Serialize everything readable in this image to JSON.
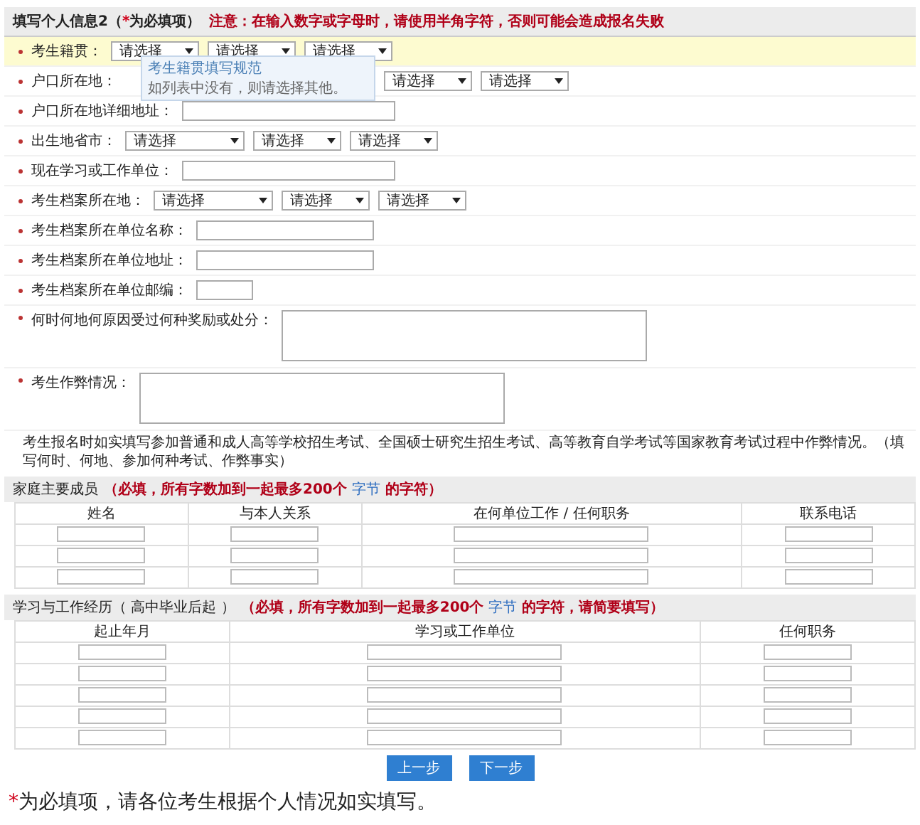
{
  "header": {
    "title": "填写个人信息2（",
    "required_mark": "*",
    "title_end": "为必填项）",
    "warning": "注意：在输入数字或字母时，请使用半角字符，否则可能会造成报名失败"
  },
  "tooltip": {
    "title": "考生籍贯填写规范",
    "text": "如列表中没有，则请选择其他。"
  },
  "rows": [
    {
      "label": "考生籍贯：",
      "required": true,
      "highlighted": true,
      "kind": "select",
      "selects": [
        {
          "text": "请选择",
          "kind": "narrow"
        },
        {
          "text": "请选择",
          "kind": "narrow"
        },
        {
          "text": "请选择",
          "kind": "narrow"
        }
      ]
    },
    {
      "label": "户口所在地：",
      "required": true,
      "highlighted": false,
      "kind": "select",
      "selects": [
        {
          "text": "请选择",
          "kind": "narrow"
        },
        {
          "text": "请选择",
          "kind": "narrow"
        }
      ]
    },
    {
      "label": "户口所在地详细地址：",
      "required": true,
      "highlighted": false,
      "kind": "input"
    },
    {
      "label": "出生地省市：",
      "required": true,
      "highlighted": false,
      "kind": "select",
      "selects": [
        {
          "text": "请选择",
          "kind": "wide"
        },
        {
          "text": "请选择",
          "kind": "narrow"
        },
        {
          "text": "请选择",
          "kind": "narrow"
        }
      ]
    },
    {
      "label": "现在学习或工作单位：",
      "required": true,
      "highlighted": false,
      "kind": "input"
    },
    {
      "label": "考生档案所在地：",
      "required": true,
      "highlighted": false,
      "kind": "select",
      "selects": [
        {
          "text": "请选择",
          "kind": "wide"
        },
        {
          "text": "请选择",
          "kind": "narrow"
        },
        {
          "text": "请选择",
          "kind": "narrow"
        }
      ]
    },
    {
      "label": "考生档案所在单位名称：",
      "required": true,
      "highlighted": false,
      "kind": "input"
    },
    {
      "label": "考生档案所在单位地址：",
      "required": true,
      "highlighted": false,
      "kind": "input"
    },
    {
      "label": "考生档案所在单位邮编：",
      "required": true,
      "highlighted": false,
      "kind": "input"
    },
    {
      "label": "何时何地何原因受过何种奖励或处分：",
      "required": true,
      "highlighted": false,
      "kind": "textarea"
    },
    {
      "label": "考生作弊情况：",
      "required": true,
      "highlighted": false,
      "kind": "textarea"
    }
  ],
  "cheat_note": "考生报名时如实填写参加普通和成人高等学校招生考试、全国硕士研究生招生考试、高等教育自学考试等国家教育考试过程中作弊情况。（填写何时、何地、参加何种考试、作弊事实）",
  "family": {
    "title": "家庭主要成员",
    "note_before": "（必填，所有字数加到一起最多200个 ",
    "note_link": "字节",
    "note_after": " 的字符）",
    "columns": [
      "姓名",
      "与本人关系",
      "在何单位工作 / 任何职务",
      "联系电话"
    ],
    "rows": [
      {
        "kind": "inputs"
      },
      {
        "kind": "inputs"
      },
      {
        "kind": "inputs"
      }
    ]
  },
  "study": {
    "title": "学习与工作经历（ 高中毕业后起 ）",
    "note_before": "（必填，所有字数加到一起最多200个 ",
    "note_link": "字节",
    "note_after": " 的字符，请简要填写）",
    "columns": [
      "起止年月",
      "学习或工作单位",
      "任何职务"
    ],
    "rows": [
      {
        "kind": "inputs"
      },
      {
        "kind": "inputs"
      },
      {
        "kind": "inputs"
      },
      {
        "kind": "inputs"
      },
      {
        "kind": "inputs"
      }
    ]
  },
  "buttons": [
    "上一步",
    "下一步"
  ],
  "footer": {
    "required_mark": "*",
    "text": "为必填项，请各位考生根据个人情况如实填写。"
  }
}
